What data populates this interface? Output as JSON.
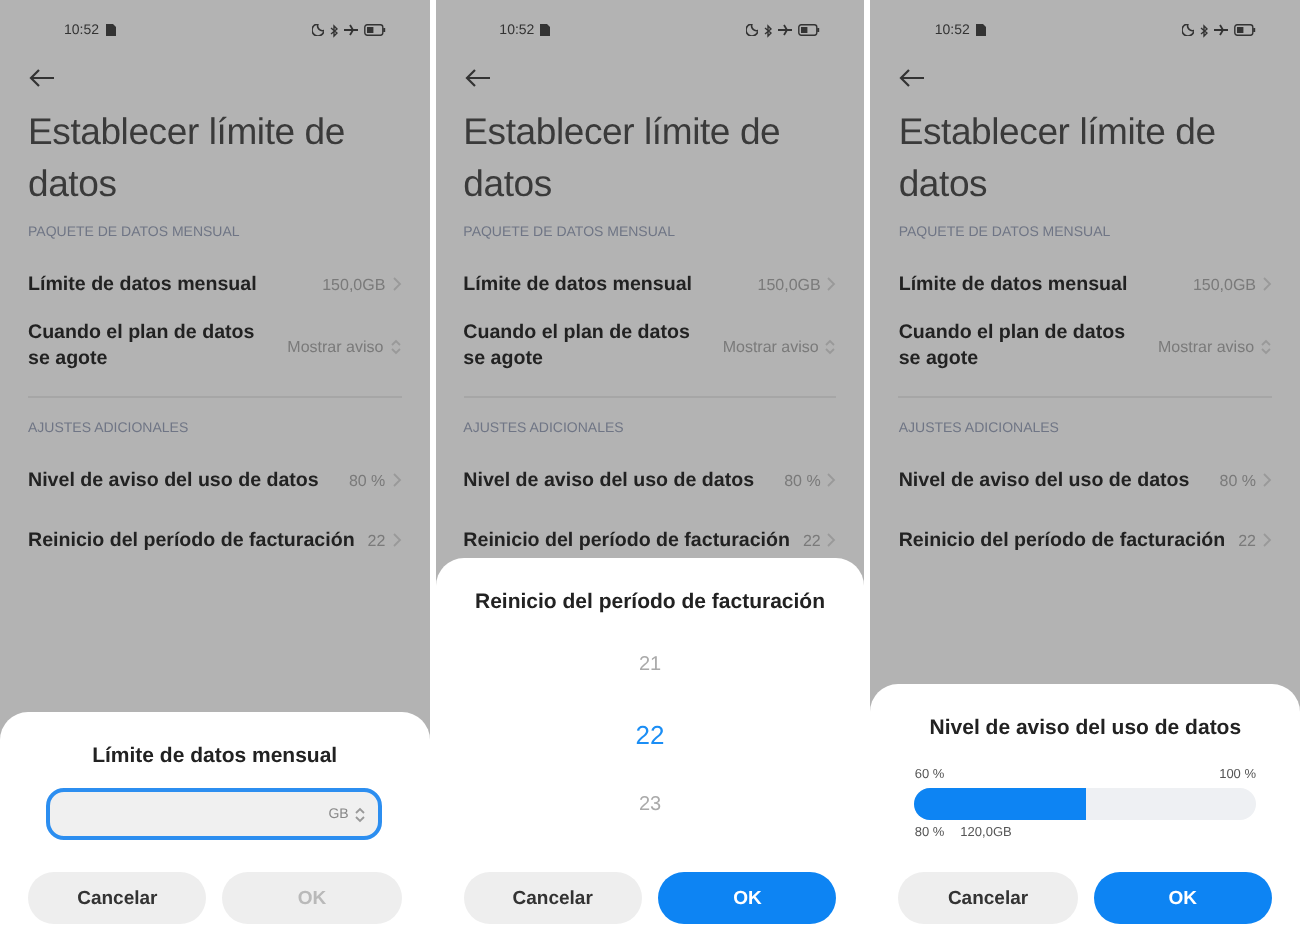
{
  "panels": [
    {
      "status": {
        "time": "10:52"
      },
      "title": "Establecer límite de datos",
      "sections": [
        {
          "header": "PAQUETE DE DATOS MENSUAL",
          "rows": [
            {
              "label": "Límite de datos mensual",
              "value": "150,0GB",
              "kind": "chevron"
            },
            {
              "label": "Cuando el plan de datos se agote",
              "value": "Mostrar aviso",
              "kind": "updown"
            }
          ]
        },
        {
          "header": "AJUSTES ADICIONALES",
          "rows": [
            {
              "label": "Nivel de aviso del uso de datos",
              "value": "80 %",
              "kind": "chevron"
            },
            {
              "label": "Reinicio del período de facturación",
              "value": "22",
              "kind": "chevron"
            }
          ]
        }
      ],
      "sheet": {
        "kind": "input",
        "title": "Límite de datos mensual",
        "unit": "GB",
        "buttons": [
          {
            "label": "Cancelar",
            "primary": false,
            "disabled": false
          },
          {
            "label": "OK",
            "primary": false,
            "disabled": true
          }
        ]
      }
    },
    {
      "status": {
        "time": "10:52"
      },
      "title": "Establecer límite de datos",
      "sections": [
        {
          "header": "PAQUETE DE DATOS MENSUAL",
          "rows": [
            {
              "label": "Límite de datos mensual",
              "value": "150,0GB",
              "kind": "chevron"
            },
            {
              "label": "Cuando el plan de datos se agote",
              "value": "Mostrar aviso",
              "kind": "updown"
            }
          ]
        },
        {
          "header": "AJUSTES ADICIONALES",
          "rows": [
            {
              "label": "Nivel de aviso del uso de datos",
              "value": "80 %",
              "kind": "chevron"
            },
            {
              "label": "Reinicio del período de facturación",
              "value": "22",
              "kind": "chevron"
            }
          ]
        }
      ],
      "sheet": {
        "kind": "picker",
        "title": "Reinicio del período de facturación",
        "options": [
          {
            "label": "21",
            "selected": false
          },
          {
            "label": "22",
            "selected": true
          },
          {
            "label": "23",
            "selected": false
          }
        ],
        "buttons": [
          {
            "label": "Cancelar",
            "primary": false,
            "disabled": false
          },
          {
            "label": "OK",
            "primary": true,
            "disabled": false
          }
        ]
      }
    },
    {
      "status": {
        "time": "10:52"
      },
      "title": "Establecer límite de datos",
      "sections": [
        {
          "header": "PAQUETE DE DATOS MENSUAL",
          "rows": [
            {
              "label": "Límite de datos mensual",
              "value": "150,0GB",
              "kind": "chevron"
            },
            {
              "label": "Cuando el plan de datos se agote",
              "value": "Mostrar aviso",
              "kind": "updown"
            }
          ]
        },
        {
          "header": "AJUSTES ADICIONALES",
          "rows": [
            {
              "label": "Nivel de aviso del uso de datos",
              "value": "80 %",
              "kind": "chevron"
            },
            {
              "label": "Reinicio del período de facturación",
              "value": "22",
              "kind": "chevron"
            }
          ]
        }
      ],
      "sheet": {
        "kind": "slider",
        "title": "Nivel de aviso del uso de datos",
        "min_label": "60 %",
        "max_label": "100 %",
        "level": 0.5,
        "reading": "80 %",
        "amount": "120,0GB",
        "buttons": [
          {
            "label": "Cancelar",
            "primary": false,
            "disabled": false
          },
          {
            "label": "OK",
            "primary": true,
            "disabled": false
          }
        ]
      }
    }
  ]
}
